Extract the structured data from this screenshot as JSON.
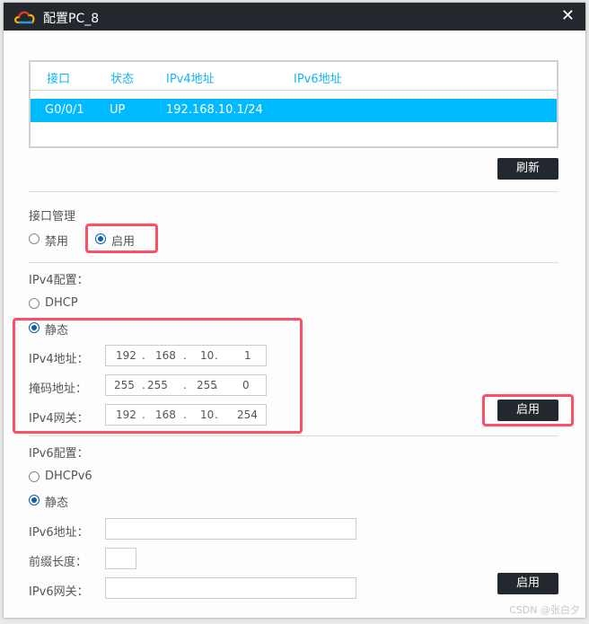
{
  "window": {
    "title": "配置PC_8",
    "close": "✕"
  },
  "table": {
    "headers": [
      "接口",
      "状态",
      "IPv4地址",
      "IPv6地址"
    ],
    "rows": [
      {
        "iface": "G0/0/1",
        "status": "UP",
        "ipv4": "192.168.10.1/24",
        "ipv6": ""
      }
    ]
  },
  "refresh_label": "刷新",
  "iface_mgmt": {
    "title": "接口管理",
    "disable": "禁用",
    "enable": "启用",
    "selected": "启用"
  },
  "ipv4": {
    "title": "IPv4配置：",
    "dhcp": "DHCP",
    "static": "静态",
    "selected": "静态",
    "addr_label": "IPv4地址：",
    "addr": [
      "192",
      "168",
      "10",
      "1"
    ],
    "mask_label": "掩码地址：",
    "mask": [
      "255",
      "255",
      "255",
      "0"
    ],
    "gw_label": "IPv4网关：",
    "gw": [
      "192",
      "168",
      "10",
      "254"
    ],
    "apply": "启用"
  },
  "ipv6": {
    "title": "IPv6配置：",
    "dhcp": "DHCPv6",
    "static": "静态",
    "selected": "静态",
    "addr_label": "IPv6地址：",
    "addr": "",
    "prefix_label": "前缀长度：",
    "prefix": "",
    "gw_label": "IPv6网关：",
    "gw": "",
    "apply": "启用"
  },
  "watermark": "CSDN @张白夕",
  "colors": {
    "titlebar": "#23272e",
    "accent": "#00baff",
    "highlight": "#ff4d64"
  }
}
